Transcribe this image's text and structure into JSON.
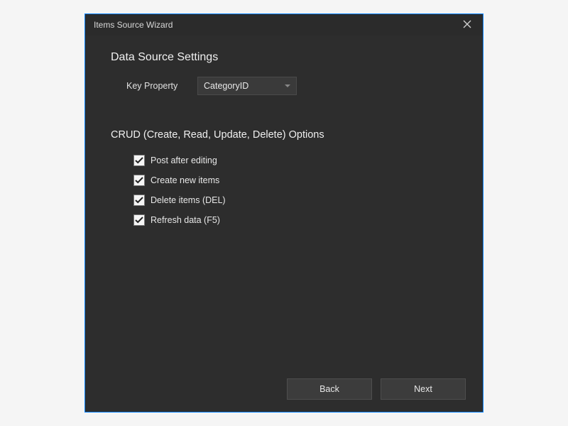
{
  "window": {
    "title": "Items Source Wizard"
  },
  "sections": {
    "dataSource": {
      "title": "Data Source Settings",
      "keyProperty": {
        "label": "Key Property",
        "value": "CategoryID"
      }
    },
    "crud": {
      "title": "CRUD (Create, Read, Update, Delete) Options",
      "options": [
        {
          "label": "Post after editing",
          "checked": true
        },
        {
          "label": "Create new items",
          "checked": true
        },
        {
          "label": "Delete items (DEL)",
          "checked": true
        },
        {
          "label": "Refresh data (F5)",
          "checked": true
        }
      ]
    }
  },
  "footer": {
    "back": "Back",
    "next": "Next"
  }
}
